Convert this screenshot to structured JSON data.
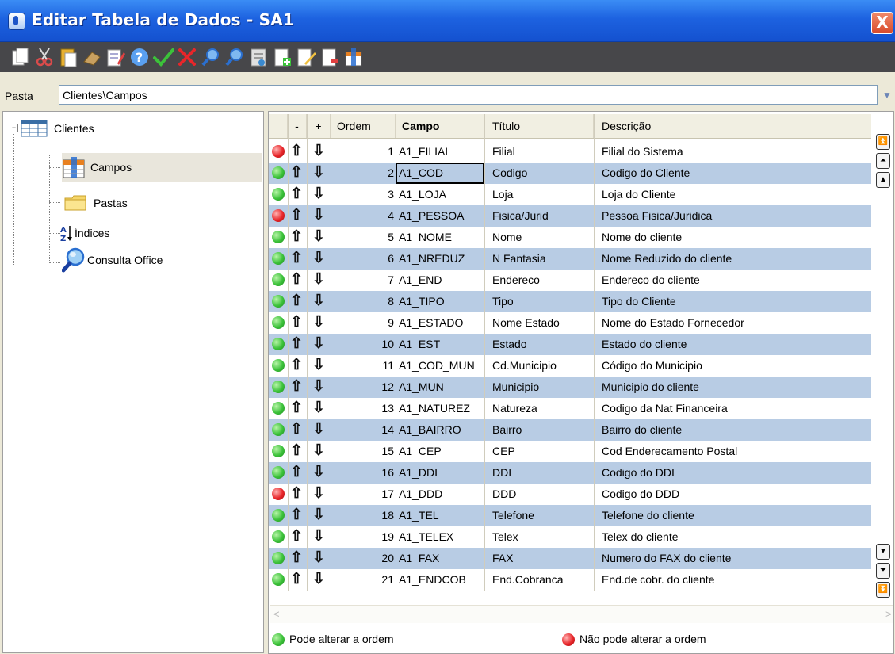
{
  "window": {
    "title": "Editar Tabela de Dados - SA1",
    "close_label": "X"
  },
  "toolbar": {
    "buttons": [
      {
        "name": "copy-icon",
        "color": "#ffffff"
      },
      {
        "name": "cut-icon",
        "color": "#d94b4b"
      },
      {
        "name": "paste-icon",
        "color": "#e8b030"
      },
      {
        "name": "eraser-icon",
        "color": "#c8a060"
      },
      {
        "name": "edit-list-icon",
        "color": "#d0d0ff"
      },
      {
        "name": "help-icon",
        "color": "#5aa0f0"
      },
      {
        "name": "check-icon",
        "color": "#3cc23a"
      },
      {
        "name": "cancel-icon",
        "color": "#e8262a"
      },
      {
        "name": "search-icon",
        "color": "#7fb8f0"
      },
      {
        "name": "search-next-icon",
        "color": "#7fb8f0"
      },
      {
        "name": "form-icon",
        "color": "#e0e0e0"
      },
      {
        "name": "add-document-icon",
        "color": "#ffffff"
      },
      {
        "name": "edit-document-icon",
        "color": "#f0c040"
      },
      {
        "name": "delete-document-icon",
        "color": "#ffffff"
      },
      {
        "name": "table-insert-icon",
        "color": "#e88020"
      }
    ]
  },
  "pasta": {
    "label": "Pasta",
    "value": "Clientes\\Campos"
  },
  "tree": {
    "root": "Clientes",
    "items": [
      "Campos",
      "Pastas",
      "Índices",
      "Consulta Office"
    ]
  },
  "grid": {
    "headers": {
      "minus": "-",
      "plus": "+",
      "ordem": "Ordem",
      "campo": "Campo",
      "titulo": "Título",
      "descricao": "Descrição"
    },
    "rows": [
      {
        "status": "red",
        "ordem": "1",
        "campo": "A1_FILIAL",
        "titulo": "Filial",
        "descricao": "Filial do Sistema"
      },
      {
        "status": "green",
        "ordem": "2",
        "campo": "A1_COD",
        "titulo": "Codigo",
        "descricao": "Codigo do Cliente"
      },
      {
        "status": "green",
        "ordem": "3",
        "campo": "A1_LOJA",
        "titulo": "Loja",
        "descricao": "Loja do Cliente"
      },
      {
        "status": "red",
        "ordem": "4",
        "campo": "A1_PESSOA",
        "titulo": "Fisica/Jurid",
        "descricao": "Pessoa Fisica/Juridica"
      },
      {
        "status": "green",
        "ordem": "5",
        "campo": "A1_NOME",
        "titulo": "Nome",
        "descricao": "Nome do cliente"
      },
      {
        "status": "green",
        "ordem": "6",
        "campo": "A1_NREDUZ",
        "titulo": "N Fantasia",
        "descricao": "Nome Reduzido do cliente"
      },
      {
        "status": "green",
        "ordem": "7",
        "campo": "A1_END",
        "titulo": "Endereco",
        "descricao": "Endereco do cliente"
      },
      {
        "status": "green",
        "ordem": "8",
        "campo": "A1_TIPO",
        "titulo": "Tipo",
        "descricao": "Tipo do Cliente"
      },
      {
        "status": "green",
        "ordem": "9",
        "campo": "A1_ESTADO",
        "titulo": "Nome Estado",
        "descricao": "Nome do Estado Fornecedor"
      },
      {
        "status": "green",
        "ordem": "10",
        "campo": "A1_EST",
        "titulo": "Estado",
        "descricao": "Estado do cliente"
      },
      {
        "status": "green",
        "ordem": "11",
        "campo": "A1_COD_MUN",
        "titulo": "Cd.Municipio",
        "descricao": "Código do Municipio"
      },
      {
        "status": "green",
        "ordem": "12",
        "campo": "A1_MUN",
        "titulo": "Municipio",
        "descricao": "Municipio do cliente"
      },
      {
        "status": "green",
        "ordem": "13",
        "campo": "A1_NATUREZ",
        "titulo": "Natureza",
        "descricao": "Codigo da Nat Financeira"
      },
      {
        "status": "green",
        "ordem": "14",
        "campo": "A1_BAIRRO",
        "titulo": "Bairro",
        "descricao": "Bairro do cliente"
      },
      {
        "status": "green",
        "ordem": "15",
        "campo": "A1_CEP",
        "titulo": "CEP",
        "descricao": "Cod Enderecamento Postal"
      },
      {
        "status": "green",
        "ordem": "16",
        "campo": "A1_DDI",
        "titulo": "DDI",
        "descricao": "Codigo do DDI"
      },
      {
        "status": "red",
        "ordem": "17",
        "campo": "A1_DDD",
        "titulo": "DDD",
        "descricao": "Codigo do DDD"
      },
      {
        "status": "green",
        "ordem": "18",
        "campo": "A1_TEL",
        "titulo": "Telefone",
        "descricao": "Telefone do cliente"
      },
      {
        "status": "green",
        "ordem": "19",
        "campo": "A1_TELEX",
        "titulo": "Telex",
        "descricao": "Telex do cliente"
      },
      {
        "status": "green",
        "ordem": "20",
        "campo": "A1_FAX",
        "titulo": "FAX",
        "descricao": "Numero do FAX do cliente"
      },
      {
        "status": "green",
        "ordem": "21",
        "campo": "A1_ENDCOB",
        "titulo": "End.Cobranca",
        "descricao": "End.de cobr. do cliente"
      }
    ],
    "current_row": 1
  },
  "legend": {
    "green_label": "Pode alterar a ordem",
    "red_label": "Não pode alterar a ordem"
  },
  "colors": {
    "alt_row": "#b8cce4",
    "green": "#3cc23a",
    "red": "#e8262a",
    "titlebar": "#1d62e0",
    "toolbar": "#47474a"
  }
}
